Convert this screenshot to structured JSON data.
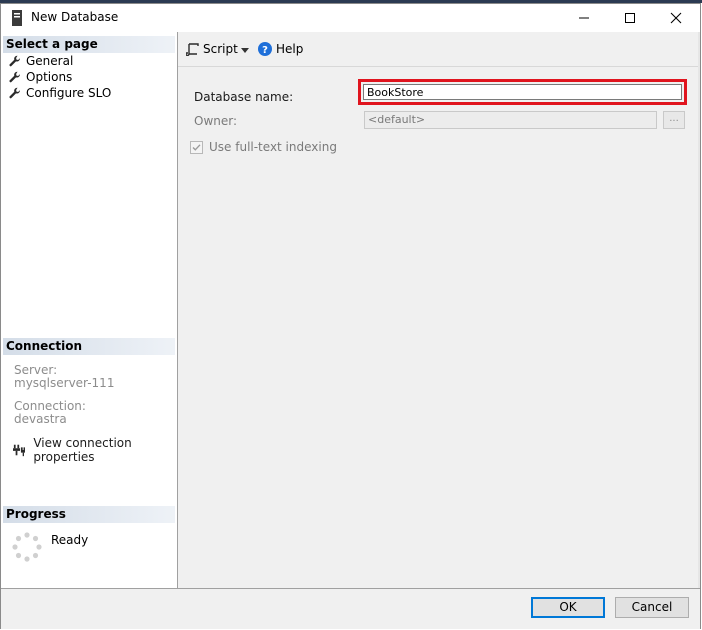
{
  "window": {
    "title": "New Database"
  },
  "select_page": {
    "header": "Select a page",
    "items": [
      {
        "label": "General",
        "icon": "wrench-icon"
      },
      {
        "label": "Options",
        "icon": "wrench-icon"
      },
      {
        "label": "Configure SLO",
        "icon": "wrench-icon"
      }
    ]
  },
  "connection": {
    "header": "Connection",
    "server_label": "Server:",
    "server_value": "mysqlserver-111",
    "connection_label": "Connection:",
    "connection_value": "devastra",
    "view_properties": "View connection properties"
  },
  "progress": {
    "header": "Progress",
    "status": "Ready"
  },
  "toolbar": {
    "script_label": "Script",
    "help_label": "Help"
  },
  "form": {
    "db_name_label": "Database name:",
    "db_name_value": "BookStore",
    "owner_label": "Owner:",
    "owner_value": "<default>",
    "owner_browse": "...",
    "fulltext_label": "Use full-text indexing",
    "fulltext_checked": true
  },
  "buttons": {
    "ok": "OK",
    "cancel": "Cancel"
  },
  "colors": {
    "highlight": "#e0141e",
    "ok_border": "#0078d7",
    "help_icon": "#1e6fd9"
  }
}
